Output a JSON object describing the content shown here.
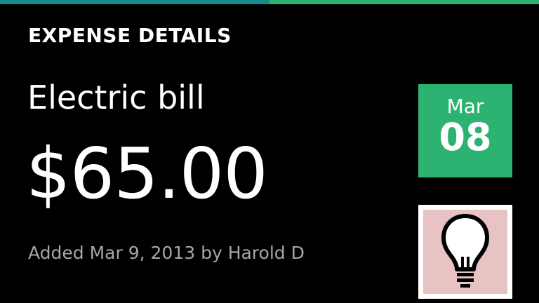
{
  "colors": {
    "background": "#000000",
    "accent_teal": "#128c8c",
    "accent_green": "#2db371",
    "text_primary": "#ffffff",
    "text_secondary": "#a6a6a6",
    "date_tile": "#2db371",
    "category_tile_fill": "#e8c3c3"
  },
  "header": {
    "title": "EXPENSE DETAILS"
  },
  "expense": {
    "name": "Electric bill",
    "amount": "$65.00",
    "added_line": "Added Mar 9, 2013 by Harold D"
  },
  "date_tile": {
    "month": "Mar",
    "day": "08"
  },
  "category_tile": {
    "icon": "lightbulb-icon"
  }
}
